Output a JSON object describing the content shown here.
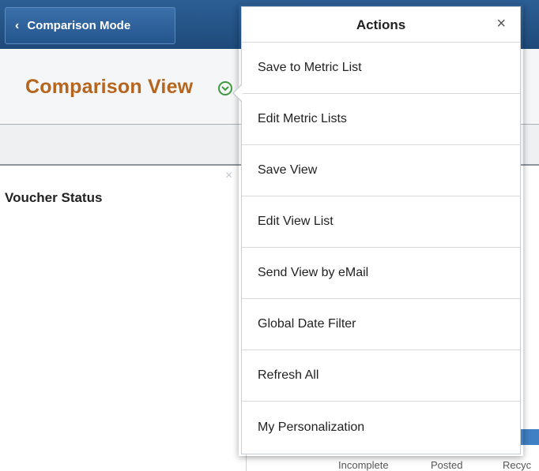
{
  "header": {
    "back_label": "Comparison Mode"
  },
  "page": {
    "title": "Comparison View"
  },
  "tile": {
    "title": "Voucher Status",
    "close_glyph": "×"
  },
  "chart_legend": [
    "Incomplete",
    "Posted",
    "Recyc"
  ],
  "popup": {
    "title": "Actions",
    "close_glyph": "×",
    "items": [
      {
        "label": "Save to Metric List"
      },
      {
        "label": "Edit Metric Lists"
      },
      {
        "label": "Save View"
      },
      {
        "label": "Edit View List"
      },
      {
        "label": "Send View by eMail"
      },
      {
        "label": "Global Date Filter"
      },
      {
        "label": "Refresh All"
      },
      {
        "label": "My Personalization"
      }
    ]
  },
  "colors": {
    "header_bg": "#1e4a7a",
    "title_text": "#b5651d",
    "dropdown_icon": "#3f9a3f",
    "chart_bar": "#3f7fc4"
  },
  "icons": {
    "back": "chevron-left-icon",
    "title_dropdown": "chevron-down-circle-icon",
    "popup_close": "close-icon",
    "tile_close": "close-icon"
  }
}
